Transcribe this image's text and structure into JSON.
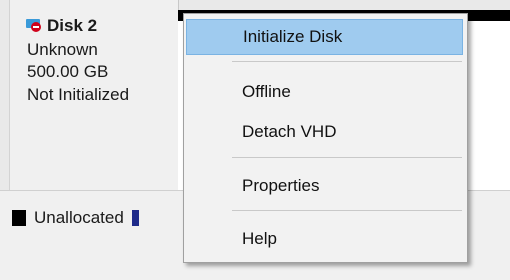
{
  "disk": {
    "name": "Disk 2",
    "type": "Unknown",
    "size": "500.00 GB",
    "status": "Not Initialized"
  },
  "legend": {
    "unallocated_label": "Unallocated"
  },
  "context_menu": {
    "items": [
      {
        "label": "Initialize Disk",
        "highlighted": true
      },
      {
        "label": "Offline"
      },
      {
        "label": "Detach VHD"
      },
      {
        "label": "Properties"
      },
      {
        "label": "Help"
      }
    ]
  },
  "colors": {
    "highlight": "#9fcbef",
    "disk_error_icon": "#d0021b",
    "disk_icon": "#3a9ad9"
  }
}
